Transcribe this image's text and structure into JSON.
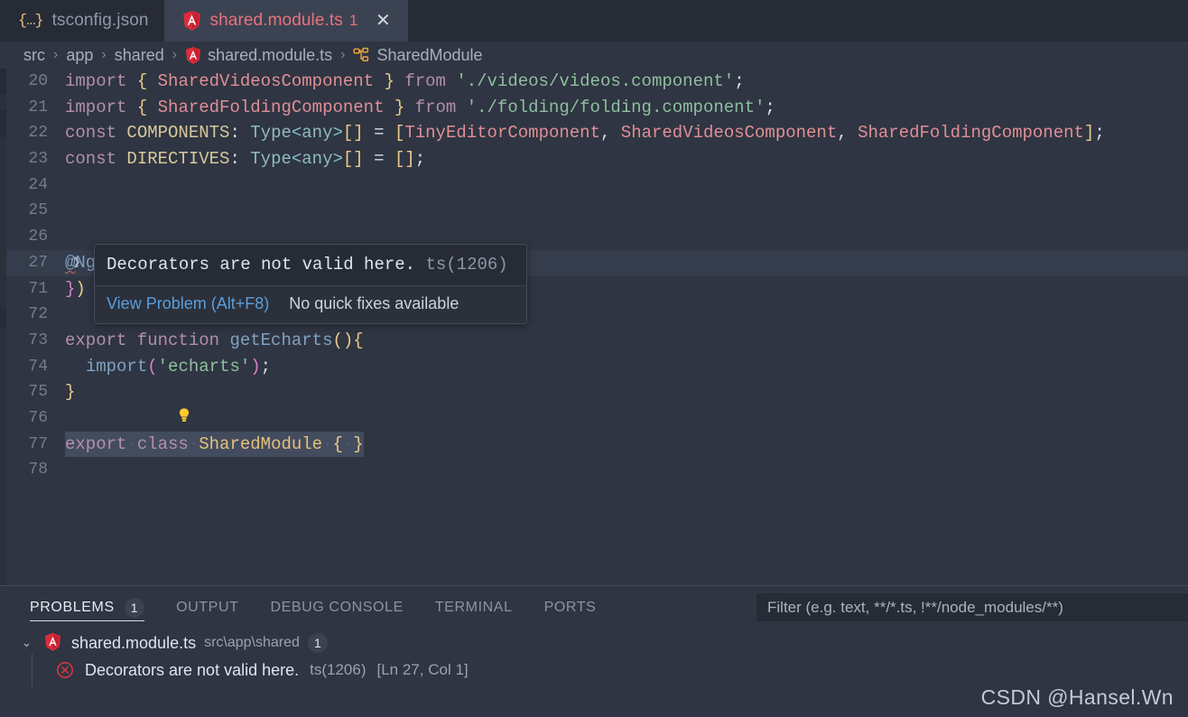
{
  "tabs": [
    {
      "label": "tsconfig.json",
      "icon": "json-braces-icon",
      "active": false,
      "badge": ""
    },
    {
      "label": "shared.module.ts",
      "icon": "angular-icon",
      "active": true,
      "badge": "1",
      "close": "✕"
    }
  ],
  "breadcrumb": {
    "separator": "›",
    "items": [
      {
        "label": "src",
        "icon": ""
      },
      {
        "label": "app",
        "icon": ""
      },
      {
        "label": "shared",
        "icon": ""
      },
      {
        "label": "shared.module.ts",
        "icon": "angular-icon"
      },
      {
        "label": "SharedModule",
        "icon": "class-symbol-icon"
      }
    ]
  },
  "editor": {
    "lines": [
      {
        "no": "20",
        "html": "i20"
      },
      {
        "no": "21",
        "html": "i21"
      },
      {
        "no": "22",
        "html": "i22"
      },
      {
        "no": "23",
        "html": "i23"
      },
      {
        "no": "24",
        "html": ""
      },
      {
        "no": "25",
        "html": ""
      },
      {
        "no": "26",
        "html": ""
      },
      {
        "no": "27",
        "html": "i27"
      },
      {
        "no": "71",
        "html": "i71"
      },
      {
        "no": "72",
        "html": ""
      },
      {
        "no": "73",
        "html": "i73"
      },
      {
        "no": "74",
        "html": "i74"
      },
      {
        "no": "75",
        "html": "i75"
      },
      {
        "no": "76",
        "html": "i76"
      },
      {
        "no": "77",
        "html": "i77"
      },
      {
        "no": "78",
        "html": ""
      }
    ],
    "text": {
      "l20": "import { SharedVideosComponent } from './videos/videos.component';",
      "l21": "import { SharedFoldingComponent } from './folding/folding.component';",
      "l22": "const COMPONENTS: Type<any>[] = [TinyEditorComponent, SharedVideosComponent, SharedFoldingComponent];",
      "l23": "const DIRECTIVES: Type<any>[] = [];",
      "l27": "@NgModule({ ⋯",
      "l71": "})",
      "l73": "export function getEcharts(){",
      "l74": "  import('echarts');",
      "l75": "}",
      "l77": "export class SharedModule { }"
    },
    "fold_chevron": "❯",
    "collapsed_dots": "⋯",
    "lightbulb": "lightbulb-icon"
  },
  "hover": {
    "message": "Decorators are not valid here.",
    "code": "ts(1206)",
    "link": "View Problem (Alt+F8)",
    "note": "No quick fixes available"
  },
  "panel": {
    "tabs": [
      {
        "label": "PROBLEMS",
        "badge": "1",
        "active": true
      },
      {
        "label": "OUTPUT",
        "badge": "",
        "active": false
      },
      {
        "label": "DEBUG CONSOLE",
        "badge": "",
        "active": false
      },
      {
        "label": "TERMINAL",
        "badge": "",
        "active": false
      },
      {
        "label": "PORTS",
        "badge": "",
        "active": false
      }
    ],
    "filter": {
      "value": "",
      "placeholder": "Filter (e.g. text, **/*.ts, !**/node_modules/**)"
    },
    "problems": {
      "chevron": "⌄",
      "file": "shared.module.ts",
      "path": "src\\app\\shared",
      "count": "1",
      "items": [
        {
          "severity": "error",
          "message": "Decorators are not valid here.",
          "code": "ts(1206)",
          "location": "[Ln 27, Col 1]"
        }
      ]
    }
  },
  "watermark": "CSDN @Hansel.Wn",
  "colors": {
    "editor_bg": "#2f3542",
    "tabbar_bg": "#272b36",
    "active_tab_bg": "#3b4252",
    "error_red": "#e8727a",
    "link_blue": "#5b9dd9",
    "selection": "#434c5e",
    "current_line": "#353c4b"
  }
}
